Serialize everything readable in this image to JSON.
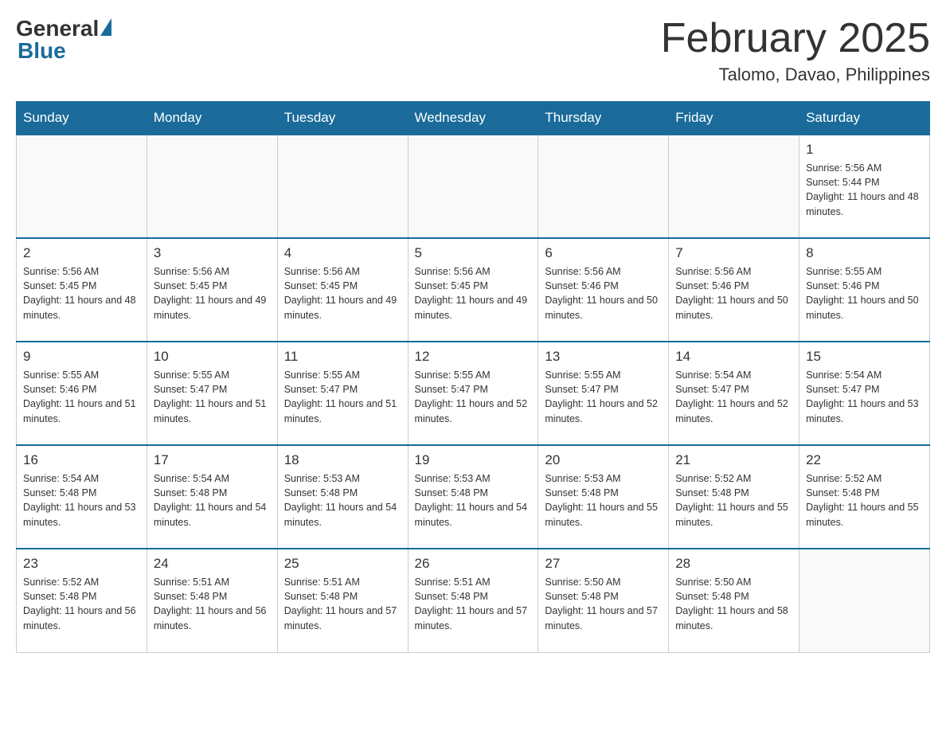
{
  "header": {
    "logo_general": "General",
    "logo_blue": "Blue",
    "month_title": "February 2025",
    "location": "Talomo, Davao, Philippines"
  },
  "weekdays": [
    "Sunday",
    "Monday",
    "Tuesday",
    "Wednesday",
    "Thursday",
    "Friday",
    "Saturday"
  ],
  "weeks": [
    [
      {
        "day": "",
        "info": ""
      },
      {
        "day": "",
        "info": ""
      },
      {
        "day": "",
        "info": ""
      },
      {
        "day": "",
        "info": ""
      },
      {
        "day": "",
        "info": ""
      },
      {
        "day": "",
        "info": ""
      },
      {
        "day": "1",
        "info": "Sunrise: 5:56 AM\nSunset: 5:44 PM\nDaylight: 11 hours and 48 minutes."
      }
    ],
    [
      {
        "day": "2",
        "info": "Sunrise: 5:56 AM\nSunset: 5:45 PM\nDaylight: 11 hours and 48 minutes."
      },
      {
        "day": "3",
        "info": "Sunrise: 5:56 AM\nSunset: 5:45 PM\nDaylight: 11 hours and 49 minutes."
      },
      {
        "day": "4",
        "info": "Sunrise: 5:56 AM\nSunset: 5:45 PM\nDaylight: 11 hours and 49 minutes."
      },
      {
        "day": "5",
        "info": "Sunrise: 5:56 AM\nSunset: 5:45 PM\nDaylight: 11 hours and 49 minutes."
      },
      {
        "day": "6",
        "info": "Sunrise: 5:56 AM\nSunset: 5:46 PM\nDaylight: 11 hours and 50 minutes."
      },
      {
        "day": "7",
        "info": "Sunrise: 5:56 AM\nSunset: 5:46 PM\nDaylight: 11 hours and 50 minutes."
      },
      {
        "day": "8",
        "info": "Sunrise: 5:55 AM\nSunset: 5:46 PM\nDaylight: 11 hours and 50 minutes."
      }
    ],
    [
      {
        "day": "9",
        "info": "Sunrise: 5:55 AM\nSunset: 5:46 PM\nDaylight: 11 hours and 51 minutes."
      },
      {
        "day": "10",
        "info": "Sunrise: 5:55 AM\nSunset: 5:47 PM\nDaylight: 11 hours and 51 minutes."
      },
      {
        "day": "11",
        "info": "Sunrise: 5:55 AM\nSunset: 5:47 PM\nDaylight: 11 hours and 51 minutes."
      },
      {
        "day": "12",
        "info": "Sunrise: 5:55 AM\nSunset: 5:47 PM\nDaylight: 11 hours and 52 minutes."
      },
      {
        "day": "13",
        "info": "Sunrise: 5:55 AM\nSunset: 5:47 PM\nDaylight: 11 hours and 52 minutes."
      },
      {
        "day": "14",
        "info": "Sunrise: 5:54 AM\nSunset: 5:47 PM\nDaylight: 11 hours and 52 minutes."
      },
      {
        "day": "15",
        "info": "Sunrise: 5:54 AM\nSunset: 5:47 PM\nDaylight: 11 hours and 53 minutes."
      }
    ],
    [
      {
        "day": "16",
        "info": "Sunrise: 5:54 AM\nSunset: 5:48 PM\nDaylight: 11 hours and 53 minutes."
      },
      {
        "day": "17",
        "info": "Sunrise: 5:54 AM\nSunset: 5:48 PM\nDaylight: 11 hours and 54 minutes."
      },
      {
        "day": "18",
        "info": "Sunrise: 5:53 AM\nSunset: 5:48 PM\nDaylight: 11 hours and 54 minutes."
      },
      {
        "day": "19",
        "info": "Sunrise: 5:53 AM\nSunset: 5:48 PM\nDaylight: 11 hours and 54 minutes."
      },
      {
        "day": "20",
        "info": "Sunrise: 5:53 AM\nSunset: 5:48 PM\nDaylight: 11 hours and 55 minutes."
      },
      {
        "day": "21",
        "info": "Sunrise: 5:52 AM\nSunset: 5:48 PM\nDaylight: 11 hours and 55 minutes."
      },
      {
        "day": "22",
        "info": "Sunrise: 5:52 AM\nSunset: 5:48 PM\nDaylight: 11 hours and 55 minutes."
      }
    ],
    [
      {
        "day": "23",
        "info": "Sunrise: 5:52 AM\nSunset: 5:48 PM\nDaylight: 11 hours and 56 minutes."
      },
      {
        "day": "24",
        "info": "Sunrise: 5:51 AM\nSunset: 5:48 PM\nDaylight: 11 hours and 56 minutes."
      },
      {
        "day": "25",
        "info": "Sunrise: 5:51 AM\nSunset: 5:48 PM\nDaylight: 11 hours and 57 minutes."
      },
      {
        "day": "26",
        "info": "Sunrise: 5:51 AM\nSunset: 5:48 PM\nDaylight: 11 hours and 57 minutes."
      },
      {
        "day": "27",
        "info": "Sunrise: 5:50 AM\nSunset: 5:48 PM\nDaylight: 11 hours and 57 minutes."
      },
      {
        "day": "28",
        "info": "Sunrise: 5:50 AM\nSunset: 5:48 PM\nDaylight: 11 hours and 58 minutes."
      },
      {
        "day": "",
        "info": ""
      }
    ]
  ]
}
